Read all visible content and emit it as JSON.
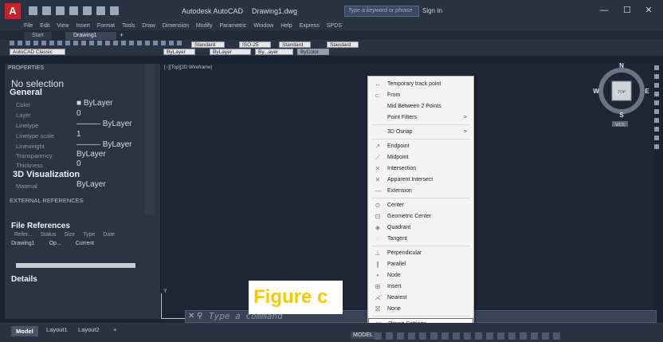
{
  "titlebar": {
    "app_title": "Autodesk AutoCAD",
    "doc_title": "Drawing1.dwg",
    "search_placeholder": "Type a keyword or phrase",
    "sign_in": "Sign In",
    "minimize": "—",
    "maximize": "☐",
    "close": "✕"
  },
  "menu": [
    "File",
    "Edit",
    "View",
    "Insert",
    "Format",
    "Tools",
    "Draw",
    "Dimension",
    "Modify",
    "Parametric",
    "Window",
    "Help",
    "Express",
    "SPDS"
  ],
  "tabs": {
    "start": "Start",
    "drawing": "Drawing1",
    "plus": "+"
  },
  "toolbar": {
    "text_style": "Standard",
    "dim_style": "ISO-25",
    "table_style": "Standard",
    "mleader_style": "Standard",
    "workspace": "AutoCAD Classic",
    "layer": "ByLayer",
    "linetype": "ByLayer",
    "lineweight": "By...ayer",
    "color": "ByColor"
  },
  "properties": {
    "header": "PROPERTIES",
    "selection": "No selection",
    "general_title": "General",
    "general": [
      {
        "label": "Color",
        "value": "■ ByLayer"
      },
      {
        "label": "Layer",
        "value": "0"
      },
      {
        "label": "Linetype",
        "value": "——— ByLayer"
      },
      {
        "label": "Linetype scale",
        "value": "1"
      },
      {
        "label": "Lineweight",
        "value": "——— ByLayer"
      },
      {
        "label": "Transparency",
        "value": "ByLayer"
      },
      {
        "label": "Thickness",
        "value": "0"
      }
    ],
    "viz_title": "3D Visualization",
    "viz": [
      {
        "label": "Material",
        "value": "ByLayer"
      }
    ]
  },
  "external_references": {
    "header": "EXTERNAL REFERENCES",
    "file_refs_title": "File References",
    "columns": [
      "Refer...",
      "Status",
      "Size",
      "Type",
      "Date"
    ],
    "rows": [
      {
        "name": "Drawing1",
        "status": "Op...",
        "type": "Current"
      }
    ],
    "details_title": "Details"
  },
  "viewport": {
    "label": "[−][Top][2D Wireframe]",
    "ucs_y": "Y"
  },
  "viewcube": {
    "north": "N",
    "south": "S",
    "east": "E",
    "west": "W",
    "top": "TOP",
    "wcs": "WCS"
  },
  "context_menu": [
    {
      "icon": "↔",
      "label": "Temporary track point",
      "arrow": ""
    },
    {
      "icon": "⊏",
      "label": "From",
      "arrow": ""
    },
    {
      "icon": "",
      "label": "Mid Between 2 Points",
      "arrow": ""
    },
    {
      "icon": "",
      "label": "Point Filters",
      "arrow": ">"
    },
    {
      "sep": true
    },
    {
      "icon": "",
      "label": "3D Osnap",
      "arrow": ">"
    },
    {
      "sep": true
    },
    {
      "icon": "↗",
      "label": "Endpoint",
      "arrow": ""
    },
    {
      "icon": "⟋",
      "label": "Midpoint",
      "arrow": ""
    },
    {
      "icon": "✕",
      "label": "Intersection",
      "arrow": ""
    },
    {
      "icon": "✕",
      "label": "Apparent Intersect",
      "arrow": ""
    },
    {
      "icon": "—",
      "label": "Extension",
      "arrow": ""
    },
    {
      "sep": true
    },
    {
      "icon": "⊙",
      "label": "Center",
      "arrow": ""
    },
    {
      "icon": "⊡",
      "label": "Geometric Center",
      "arrow": ""
    },
    {
      "icon": "◈",
      "label": "Quadrant",
      "arrow": ""
    },
    {
      "icon": "◌",
      "label": "Tangent",
      "arrow": ""
    },
    {
      "sep": true
    },
    {
      "icon": "⊥",
      "label": "Perpendicular",
      "arrow": ""
    },
    {
      "icon": "∥",
      "label": "Parallel",
      "arrow": ""
    },
    {
      "icon": "•",
      "label": "Node",
      "arrow": ""
    },
    {
      "icon": "⊞",
      "label": "Insert",
      "arrow": ""
    },
    {
      "icon": "⋌",
      "label": "Nearest",
      "arrow": ""
    },
    {
      "icon": "⛝",
      "label": "None",
      "arrow": ""
    },
    {
      "sep": true
    },
    {
      "icon": "▣",
      "label": "Osnap Settings...",
      "arrow": "",
      "boxed": true
    }
  ],
  "command": {
    "placeholder": "Type a command"
  },
  "overlay": {
    "text": "Figure c",
    "color": "#f8c800"
  },
  "layout_tabs": [
    "Model",
    "Layout1",
    "Layout2",
    "+"
  ],
  "status": {
    "model": "MODEL"
  }
}
